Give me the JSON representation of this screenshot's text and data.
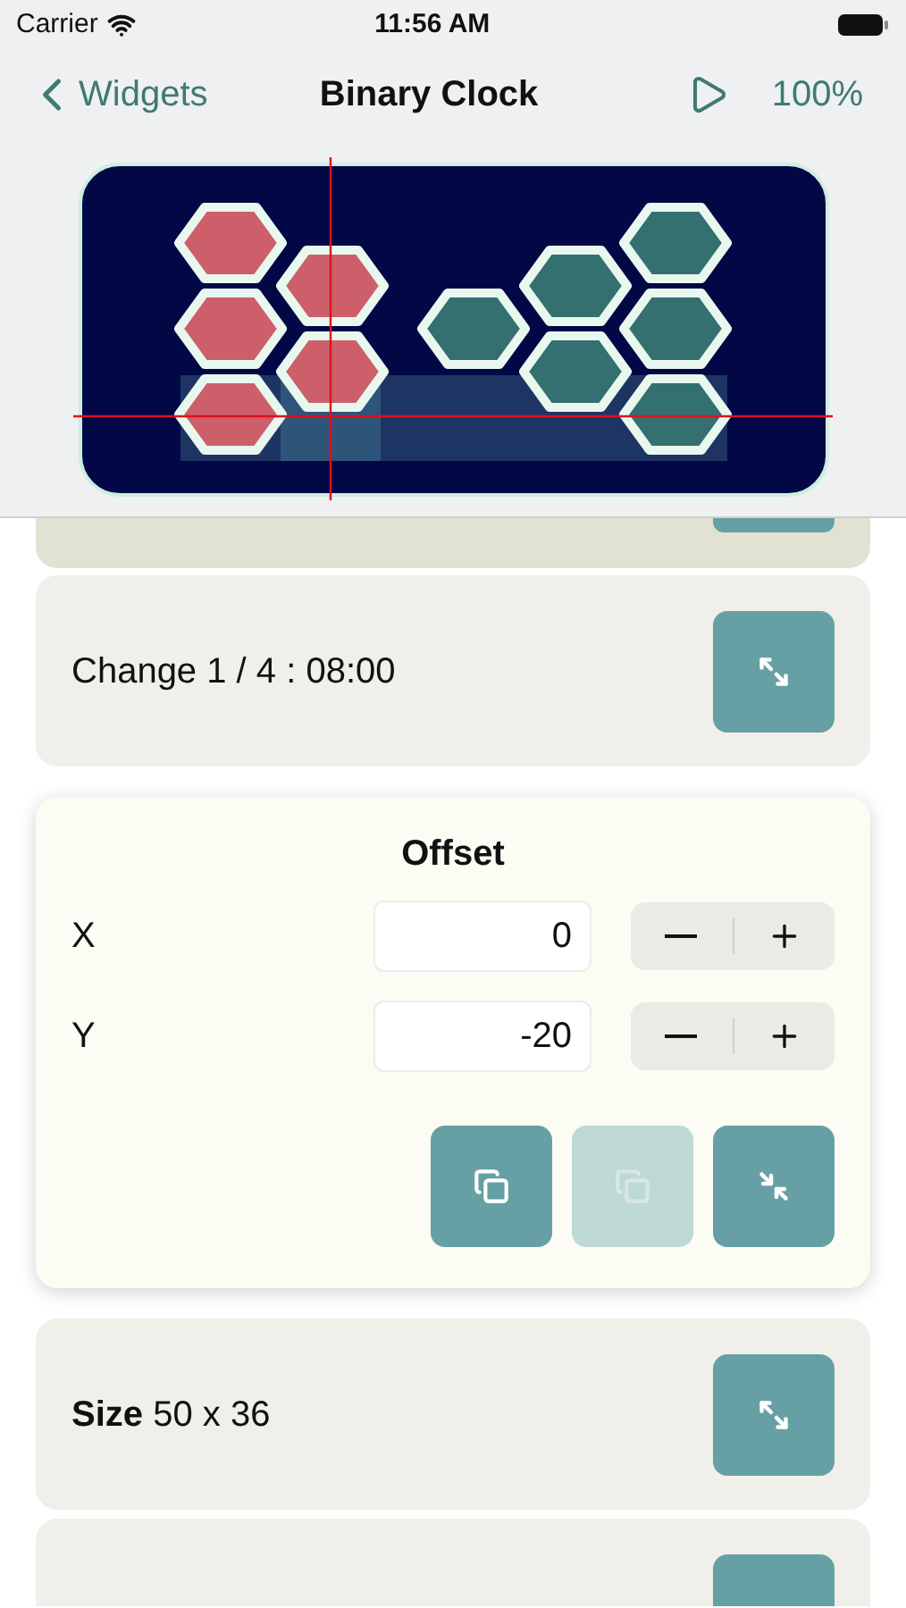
{
  "status_bar": {
    "carrier": "Carrier",
    "time": "11:56 AM"
  },
  "nav": {
    "back_label": "Widgets",
    "title": "Binary Clock",
    "zoom": "100%"
  },
  "cards": [
    {
      "kind": "partial_top"
    },
    {
      "kind": "row",
      "label": "Change 1 / 4 : 08:00"
    },
    {
      "kind": "offset",
      "title": "Offset",
      "fields": [
        {
          "label": "X",
          "value": "0"
        },
        {
          "label": "Y",
          "value": "-20"
        }
      ],
      "buttons": [
        {
          "kind": "copy",
          "disabled": false
        },
        {
          "kind": "paste",
          "disabled": true
        },
        {
          "kind": "collapse",
          "disabled": false
        }
      ]
    },
    {
      "kind": "row",
      "label": "**Size** 50 x 36"
    },
    {
      "kind": "partial_bottom"
    }
  ]
}
